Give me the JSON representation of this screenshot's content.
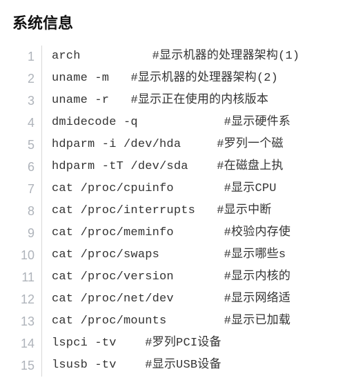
{
  "title": "系统信息",
  "lines": [
    {
      "n": "1",
      "cmd": "arch",
      "pad": 10,
      "comment": "#显示机器的处理器架构(1)"
    },
    {
      "n": "2",
      "cmd": "uname -m",
      "pad": 3,
      "comment": "#显示机器的处理器架构(2)"
    },
    {
      "n": "3",
      "cmd": "uname -r",
      "pad": 3,
      "comment": "#显示正在使用的内核版本"
    },
    {
      "n": "4",
      "cmd": "dmidecode -q",
      "pad": 12,
      "comment": "#显示硬件系"
    },
    {
      "n": "5",
      "cmd": "hdparm -i /dev/hda",
      "pad": 5,
      "comment": "#罗列一个磁"
    },
    {
      "n": "6",
      "cmd": "hdparm -tT /dev/sda",
      "pad": 4,
      "comment": "#在磁盘上执"
    },
    {
      "n": "7",
      "cmd": "cat /proc/cpuinfo",
      "pad": 7,
      "comment": "#显示CPU "
    },
    {
      "n": "8",
      "cmd": "cat /proc/interrupts",
      "pad": 3,
      "comment": "#显示中断"
    },
    {
      "n": "9",
      "cmd": "cat /proc/meminfo",
      "pad": 7,
      "comment": "#校验内存使"
    },
    {
      "n": "10",
      "cmd": "cat /proc/swaps",
      "pad": 9,
      "comment": "#显示哪些s"
    },
    {
      "n": "11",
      "cmd": "cat /proc/version",
      "pad": 7,
      "comment": "#显示内核的"
    },
    {
      "n": "12",
      "cmd": "cat /proc/net/dev",
      "pad": 7,
      "comment": "#显示网络适"
    },
    {
      "n": "13",
      "cmd": "cat /proc/mounts",
      "pad": 8,
      "comment": "#显示已加载"
    },
    {
      "n": "14",
      "cmd": "lspci -tv",
      "pad": 4,
      "comment": "#罗列PCI设备"
    },
    {
      "n": "15",
      "cmd": "lsusb -tv",
      "pad": 4,
      "comment": "#显示USB设备"
    }
  ]
}
